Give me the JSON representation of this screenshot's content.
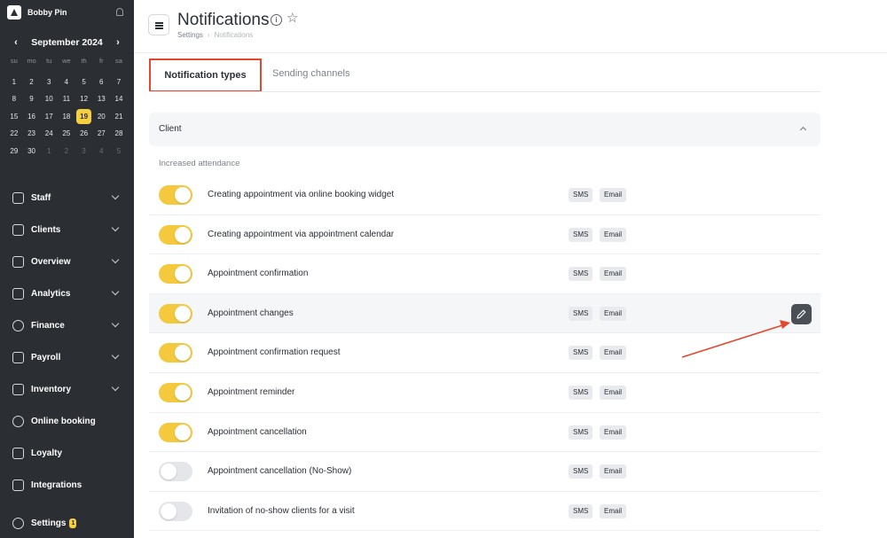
{
  "sidebar": {
    "user_name": "Bobby Pin",
    "calendar": {
      "month_label": "September 2024",
      "weekdays": [
        "su",
        "mo",
        "tu",
        "we",
        "th",
        "fr",
        "sa"
      ],
      "weeks": [
        [
          "1",
          "2",
          "3",
          "4",
          "5",
          "6",
          "7"
        ],
        [
          "8",
          "9",
          "10",
          "11",
          "12",
          "13",
          "14"
        ],
        [
          "15",
          "16",
          "17",
          "18",
          "19",
          "20",
          "21"
        ],
        [
          "22",
          "23",
          "24",
          "25",
          "26",
          "27",
          "28"
        ],
        [
          "29",
          "30",
          "1",
          "2",
          "3",
          "4",
          "5"
        ]
      ],
      "selected_day": "19"
    },
    "nav": [
      {
        "label": "Staff",
        "icon": "user-icon",
        "expandable": true
      },
      {
        "label": "Clients",
        "icon": "users-icon",
        "expandable": true
      },
      {
        "label": "Overview",
        "icon": "grid-icon",
        "expandable": true
      },
      {
        "label": "Analytics",
        "icon": "chart-icon",
        "expandable": true
      },
      {
        "label": "Finance",
        "icon": "dollar-icon",
        "expandable": true
      },
      {
        "label": "Payroll",
        "icon": "payroll-icon",
        "expandable": true
      },
      {
        "label": "Inventory",
        "icon": "box-icon",
        "expandable": true
      },
      {
        "label": "Online booking",
        "icon": "globe-icon",
        "expandable": false
      },
      {
        "label": "Loyalty",
        "icon": "percent-icon",
        "expandable": false
      },
      {
        "label": "Integrations",
        "icon": "integrations-icon",
        "expandable": false
      }
    ],
    "settings": {
      "label": "Settings",
      "badge": "1"
    }
  },
  "header": {
    "title": "Notifications",
    "breadcrumb": [
      "Settings",
      "Notifications"
    ]
  },
  "tabs": [
    {
      "label": "Notification types",
      "active": true
    },
    {
      "label": "Sending channels",
      "active": false
    }
  ],
  "section": {
    "title": "Client",
    "group_label": "Increased attendance"
  },
  "channels": {
    "sms": "SMS",
    "email": "Email"
  },
  "notifications": [
    {
      "label": "Creating appointment via online booking widget",
      "enabled": true
    },
    {
      "label": "Creating appointment via appointment calendar",
      "enabled": true
    },
    {
      "label": "Appointment confirmation",
      "enabled": true
    },
    {
      "label": "Appointment changes",
      "enabled": true
    },
    {
      "label": "Appointment confirmation request",
      "enabled": true
    },
    {
      "label": "Appointment reminder",
      "enabled": true
    },
    {
      "label": "Appointment cancellation",
      "enabled": true
    },
    {
      "label": "Appointment cancellation (No-Show)",
      "enabled": false
    },
    {
      "label": "Invitation of no-show clients for a visit",
      "enabled": false
    }
  ],
  "colors": {
    "accent": "#f4c93e",
    "sidebar": "#2b2e33",
    "annotation": "#e2482e"
  }
}
